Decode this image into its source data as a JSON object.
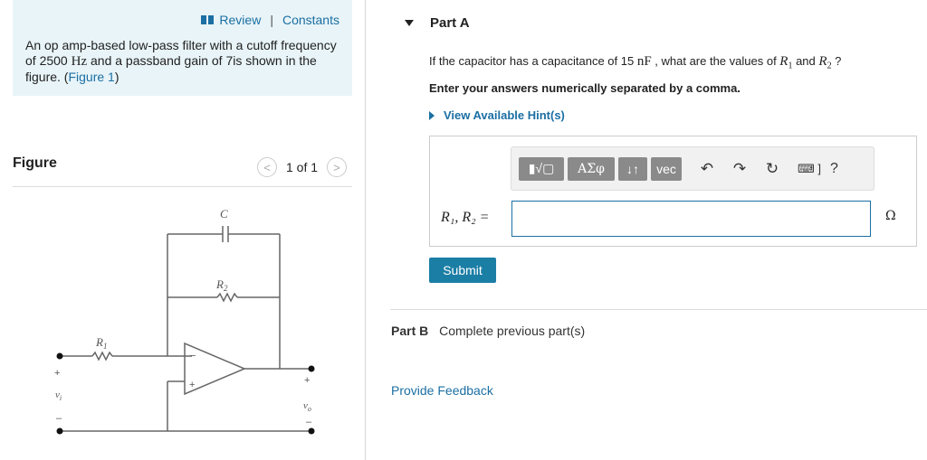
{
  "info": {
    "review_label": "Review",
    "separator": "|",
    "constants_label": "Constants",
    "desc_pre": "An op amp-based low-pass filter with a cutoff frequency of 2500 ",
    "desc_unit": "Hz",
    "desc_post": " and a passband gain of 7is shown in the figure. (",
    "figure_link": "Figure 1",
    "desc_close": ")"
  },
  "figure": {
    "title": "Figure",
    "prev_icon": "<",
    "count": "1 of 1",
    "next_icon": ">",
    "labels": {
      "c": "C",
      "r2": "R",
      "r2_sub": "2",
      "r1": "R",
      "r1_sub": "1",
      "plus_in": "+",
      "vi": "v",
      "vi_sub": "i",
      "minus_in": "–",
      "op_minus": "−",
      "op_plus": "+",
      "plus_out": "+",
      "vo": "v",
      "vo_sub": "o",
      "minus_out": "–"
    }
  },
  "part_a": {
    "title": "Part A",
    "question_pre": "If the capacitor has a capacitance of 15 ",
    "question_unit": "nF",
    "question_mid": " , what are the values of ",
    "r1": "R",
    "r1_sub": "1",
    "and": " and ",
    "r2": "R",
    "r2_sub": "2",
    "question_post": " ?",
    "instruction": "Enter your answers numerically separated by a comma.",
    "hints_label": "View Available Hint(s)",
    "toolbar": {
      "templates": "▮√▢",
      "symbols": "ΑΣφ",
      "arrows": "↓↑",
      "vec": "vec",
      "undo": "↶",
      "redo": "↷",
      "reset": "↻",
      "keyboard": "⌨ ]",
      "help": "?"
    },
    "answer_label": "R₁, R₂ =",
    "answer_value": "",
    "answer_unit": "Ω",
    "submit_label": "Submit"
  },
  "part_b": {
    "title": "Part B",
    "status": "Complete previous part(s)"
  },
  "feedback_label": "Provide Feedback"
}
